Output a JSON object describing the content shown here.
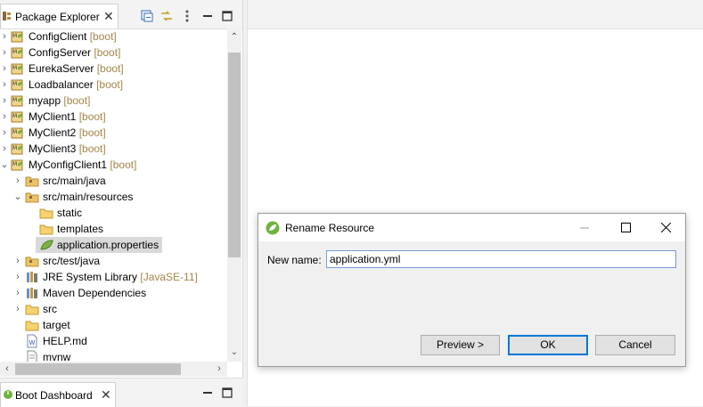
{
  "package_explorer": {
    "tab_label": "Package Explorer",
    "items": [
      {
        "label": "ConfigClient",
        "decoration": "[boot]"
      },
      {
        "label": "ConfigServer",
        "decoration": "[boot]"
      },
      {
        "label": "EurekaServer",
        "decoration": "[boot]"
      },
      {
        "label": "Loadbalancer",
        "decoration": "[boot]"
      },
      {
        "label": "myapp",
        "decoration": "[boot]"
      },
      {
        "label": "MyClient1",
        "decoration": "[boot]"
      },
      {
        "label": "MyClient2",
        "decoration": "[boot]"
      },
      {
        "label": "MyClient3",
        "decoration": "[boot]"
      },
      {
        "label": "MyConfigClient1",
        "decoration": "[boot]"
      },
      {
        "label": "src/main/java"
      },
      {
        "label": "src/main/resources"
      },
      {
        "label": "static"
      },
      {
        "label": "templates"
      },
      {
        "label": "application.properties"
      },
      {
        "label": "src/test/java"
      },
      {
        "label": "JRE System Library",
        "decoration": "[JavaSE-11]"
      },
      {
        "label": "Maven Dependencies"
      },
      {
        "label": "src"
      },
      {
        "label": "target"
      },
      {
        "label": "HELP.md"
      },
      {
        "label": "mvnw"
      }
    ]
  },
  "boot_dashboard": {
    "tab_label": "Boot Dashboard"
  },
  "dialog": {
    "title": "Rename Resource",
    "new_name_label": "New name:",
    "new_name_value": "application.yml",
    "preview_button": "Preview >",
    "ok_button": "OK",
    "cancel_button": "Cancel"
  },
  "icons": {
    "project": "spring-project-icon",
    "folder": "package-folder-icon",
    "file": "leaf-file-icon"
  },
  "colors": {
    "decoration": "#a3864a",
    "accent": "#0078d7",
    "selection": "#d9d9d9"
  }
}
